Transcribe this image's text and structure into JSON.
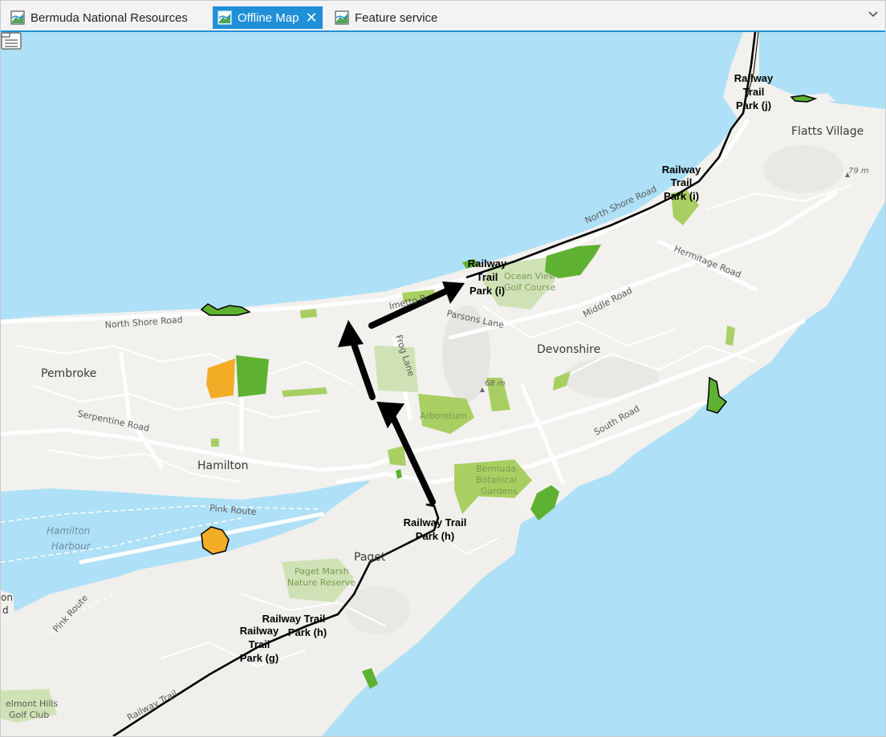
{
  "tabs": [
    {
      "label": "Bermuda National Resources",
      "active": false,
      "icon": "map-icon"
    },
    {
      "label": "Offline Map",
      "active": true,
      "icon": "map-icon"
    },
    {
      "label": "Feature service",
      "active": false,
      "icon": "map-icon"
    }
  ],
  "close_glyph": "✕",
  "map": {
    "places": {
      "pembroke": "Pembroke",
      "hamilton": "Hamilton",
      "devonshire": "Devonshire",
      "paget": "Paget",
      "flatts": "Flatts Village"
    },
    "water": {
      "harbour1": "Hamilton",
      "harbour2": "Harbour"
    },
    "roads": {
      "north_shore_w": "North Shore Road",
      "north_shore_e": "North Shore Road",
      "serpentine": "Serpentine Road",
      "frog": "Frog Lane",
      "parsons": "Parsons Lane",
      "middle": "Middle Road",
      "hermitage": "Hermitage Road",
      "south": "South Road",
      "pink1": "Pink Route",
      "pink2": "Pink Route",
      "railway": "Railway Trail",
      "palmetto": "lmetto R"
    },
    "parks": {
      "ocean1": "Ocean View",
      "ocean2": "Golf Course",
      "arboretum": "Arboretum",
      "botanical1": "Bermuda",
      "botanical2": "Botanical",
      "botanical3": "Gardens",
      "marsh1": "Paget Marsh",
      "marsh2": "Nature Reserve",
      "belmont1": "elmont Hills",
      "belmont2": "Golf Club"
    },
    "elevations": {
      "e1": "79 m",
      "e2": "68 m"
    },
    "edge_fragments": {
      "f1": "on",
      "f2": "d"
    },
    "rail_labels": {
      "j": [
        "Railway",
        "Trail",
        "Park (j)"
      ],
      "i1": [
        "Railway",
        "Trail",
        "Park (i)"
      ],
      "i2": [
        "Railway",
        "Trail",
        "Park (i)"
      ],
      "h1": [
        "Railway Trail",
        "Park (h)"
      ],
      "h2": [
        "Railway Trail",
        "Park (h)"
      ],
      "g": [
        "Railway",
        "Trail",
        "Park (g)"
      ]
    }
  },
  "colors": {
    "accent": "#1f8fd8",
    "water": "#aee0f7",
    "land": "#f2f1ee",
    "park_light": "#a9cf62",
    "park_green": "#5fb132",
    "park_orange": "#f3ac26",
    "reserve": "#cfe2b5"
  }
}
